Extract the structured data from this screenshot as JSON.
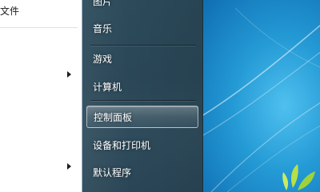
{
  "left_panel": {
    "label": "文件",
    "arrow_icons": [
      "chevron-right-icon",
      "chevron-right-icon"
    ]
  },
  "menu": {
    "items": [
      {
        "label": "图片",
        "active": false
      },
      {
        "label": "音乐",
        "active": false
      },
      {
        "label": "游戏",
        "active": false
      },
      {
        "label": "计算机",
        "active": false
      },
      {
        "label": "控制面板",
        "active": true
      },
      {
        "label": "设备和打印机",
        "active": false
      },
      {
        "label": "默认程序",
        "active": false
      }
    ]
  },
  "colors": {
    "highlight_border": "#ffffff",
    "menu_bg": "#2b4a5a",
    "desktop_blue": "#249ad5"
  }
}
